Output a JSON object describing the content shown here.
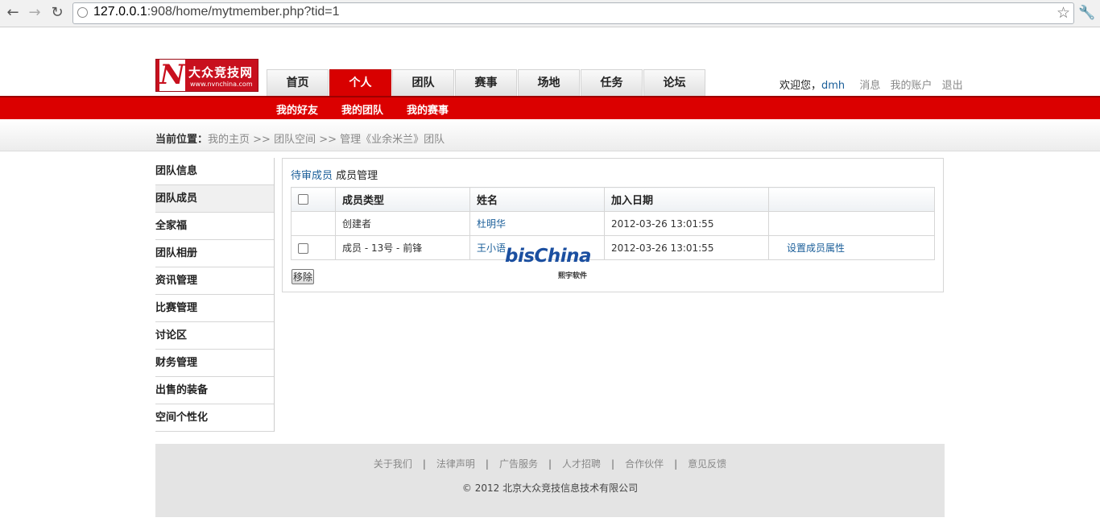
{
  "browser": {
    "url_host": "127.0.0.1",
    "url_rest": ":908/home/mytmember.php?tid=1"
  },
  "logo": {
    "letter": "N",
    "name": "大众竞技网",
    "domain": "www.nvnchina.com"
  },
  "nav_tabs": [
    "首页",
    "个人",
    "团队",
    "赛事",
    "场地",
    "任务",
    "论坛"
  ],
  "active_tab": 1,
  "user": {
    "greeting": "欢迎您，",
    "username": "dmh",
    "messages": "消息",
    "account": "我的账户",
    "logout": "退出"
  },
  "sub_nav": [
    "我的好友",
    "我的团队",
    "我的赛事"
  ],
  "breadcrumb": {
    "label": "当前位置：",
    "path": "我的主页 >> 团队空间 >> 管理《业余米兰》团队"
  },
  "sidebar": [
    "团队信息",
    "团队成员",
    "全家福",
    "团队相册",
    "资讯管理",
    "比赛管理",
    "讨论区",
    "财务管理",
    "出售的装备",
    "空间个性化"
  ],
  "sidebar_active": 1,
  "panel": {
    "pending_link": "待审成员",
    "title": "成员管理",
    "columns": [
      "成员类型",
      "姓名",
      "加入日期",
      ""
    ],
    "rows": [
      {
        "checkbox": false,
        "type": "创建者",
        "name": "杜明华",
        "date": "2012-03-26 13:01:55",
        "action": ""
      },
      {
        "checkbox": true,
        "type": "成员 - 13号 - 前锋",
        "name": "王小语",
        "date": "2012-03-26 13:01:55",
        "action": "设置成员属性"
      }
    ],
    "remove_button": "移除"
  },
  "watermark": {
    "text": "bisChina",
    "sub": "熙宇软件"
  },
  "footer": {
    "links": [
      "关于我们",
      "法律声明",
      "广告服务",
      "人才招聘",
      "合作伙伴",
      "意见反馈"
    ],
    "copyright": "© 2012 北京大众竞技信息技术有限公司"
  },
  "colors": {
    "brand_red": "#db0000",
    "link_blue": "#1a5e99"
  }
}
